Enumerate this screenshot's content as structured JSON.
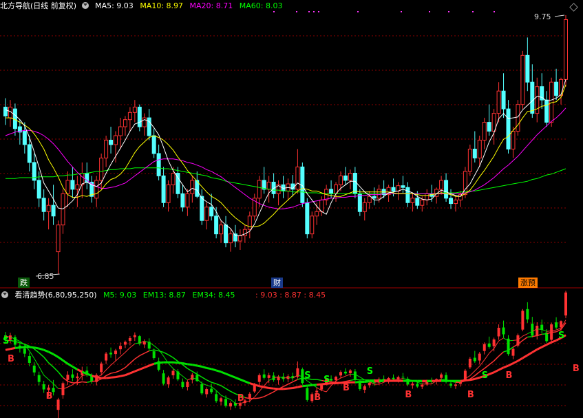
{
  "main_header": {
    "stock_name": "北方导航",
    "period": "(日线 前复权)",
    "ma5": "MA5: 9.03",
    "ma10": "MA10: 8.97",
    "ma20": "MA20: 8.71",
    "ma60": "MA60: 8.03"
  },
  "sub_header": {
    "indicator": "看清趋势(6,80,95,250)",
    "m5": "M5: 9.03",
    "em13": "EM13: 8.87",
    "em34": "EM34: 8.45",
    "values": ": 9.03 : 8.87 : 8.45"
  },
  "markers": {
    "left": "跌",
    "mid": "财",
    "right": "涨预"
  },
  "price_labels": {
    "high": "9.75",
    "low": "6.85"
  },
  "signals": {
    "buy": "B",
    "sell": "S"
  },
  "colors": {
    "up": "#ff3232",
    "down": "#54ffff",
    "ma5": "#ffffff",
    "ma10": "#ffff00",
    "ma20": "#ff00ff",
    "ma60": "#00ff00",
    "sub_up": "#ff3232",
    "sub_down": "#00e000",
    "grid": "#8b0000"
  },
  "chart_data": {
    "type": "candlestick",
    "title": "北方导航 (日线 前复权)",
    "y_high": 9.75,
    "y_low": 6.85,
    "candles": [
      [
        8.72,
        8.82,
        8.52,
        8.62
      ],
      [
        8.6,
        8.8,
        8.5,
        8.72
      ],
      [
        8.7,
        8.76,
        8.4,
        8.48
      ],
      [
        8.5,
        8.58,
        8.3,
        8.44
      ],
      [
        8.45,
        8.55,
        8.2,
        8.3
      ],
      [
        8.3,
        8.4,
        8.0,
        8.1
      ],
      [
        8.1,
        8.2,
        7.8,
        7.9
      ],
      [
        7.9,
        8.0,
        7.6,
        7.7
      ],
      [
        7.7,
        7.8,
        7.45,
        7.55
      ],
      [
        7.55,
        7.7,
        7.35,
        7.62
      ],
      [
        7.62,
        7.85,
        7.4,
        7.5
      ],
      [
        7.1,
        7.45,
        6.85,
        7.4
      ],
      [
        7.4,
        7.8,
        7.3,
        7.75
      ],
      [
        7.75,
        8.0,
        7.6,
        7.9
      ],
      [
        7.9,
        8.05,
        7.7,
        7.8
      ],
      [
        7.8,
        7.95,
        7.6,
        7.85
      ],
      [
        7.85,
        8.1,
        7.7,
        7.98
      ],
      [
        7.98,
        8.1,
        7.8,
        7.88
      ],
      [
        7.88,
        7.95,
        7.65,
        7.72
      ],
      [
        7.7,
        7.95,
        7.6,
        7.9
      ],
      [
        7.9,
        8.2,
        7.8,
        8.15
      ],
      [
        8.15,
        8.4,
        8.05,
        8.35
      ],
      [
        8.35,
        8.5,
        8.2,
        8.3
      ],
      [
        8.3,
        8.45,
        8.1,
        8.4
      ],
      [
        8.4,
        8.6,
        8.25,
        8.5
      ],
      [
        8.5,
        8.62,
        8.4,
        8.58
      ],
      [
        8.58,
        8.72,
        8.45,
        8.66
      ],
      [
        8.66,
        8.8,
        8.55,
        8.72
      ],
      [
        8.72,
        8.75,
        8.45,
        8.5
      ],
      [
        8.5,
        8.65,
        8.4,
        8.6
      ],
      [
        8.6,
        8.7,
        8.35,
        8.4
      ],
      [
        8.4,
        8.48,
        8.15,
        8.2
      ],
      [
        8.2,
        8.3,
        7.9,
        7.95
      ],
      [
        7.95,
        8.05,
        7.6,
        7.65
      ],
      [
        7.65,
        7.9,
        7.55,
        7.85
      ],
      [
        7.85,
        8.05,
        7.75,
        7.98
      ],
      [
        7.98,
        8.05,
        7.7,
        7.75
      ],
      [
        7.75,
        7.85,
        7.55,
        7.6
      ],
      [
        7.6,
        7.8,
        7.5,
        7.75
      ],
      [
        7.75,
        7.95,
        7.65,
        7.9
      ],
      [
        7.9,
        8.0,
        7.7,
        7.72
      ],
      [
        7.72,
        7.8,
        7.4,
        7.45
      ],
      [
        7.45,
        7.65,
        7.35,
        7.6
      ],
      [
        7.6,
        7.75,
        7.45,
        7.5
      ],
      [
        7.5,
        7.6,
        7.25,
        7.3
      ],
      [
        7.3,
        7.45,
        7.2,
        7.4
      ],
      [
        7.4,
        7.5,
        7.15,
        7.2
      ],
      [
        7.2,
        7.35,
        7.1,
        7.3
      ],
      [
        7.3,
        7.4,
        7.15,
        7.22
      ],
      [
        7.22,
        7.35,
        7.12,
        7.28
      ],
      [
        7.28,
        7.4,
        7.2,
        7.35
      ],
      [
        7.35,
        7.55,
        7.25,
        7.5
      ],
      [
        7.5,
        7.75,
        7.45,
        7.7
      ],
      [
        7.7,
        7.95,
        7.6,
        7.9
      ],
      [
        7.9,
        8.05,
        7.75,
        7.8
      ],
      [
        7.8,
        7.95,
        7.65,
        7.88
      ],
      [
        7.88,
        7.98,
        7.7,
        7.75
      ],
      [
        7.75,
        7.9,
        7.62,
        7.85
      ],
      [
        7.85,
        7.95,
        7.7,
        7.78
      ],
      [
        7.78,
        7.92,
        7.68,
        7.86
      ],
      [
        7.86,
        7.96,
        7.72,
        7.8
      ],
      [
        7.8,
        8.25,
        7.75,
        8.05
      ],
      [
        8.05,
        8.1,
        7.6,
        7.65
      ],
      [
        7.65,
        7.7,
        7.25,
        7.3
      ],
      [
        7.3,
        7.55,
        7.25,
        7.5
      ],
      [
        7.5,
        7.65,
        7.4,
        7.55
      ],
      [
        7.55,
        7.72,
        7.5,
        7.68
      ],
      [
        7.68,
        7.85,
        7.62,
        7.8
      ],
      [
        7.8,
        7.9,
        7.7,
        7.75
      ],
      [
        7.75,
        7.88,
        7.66,
        7.85
      ],
      [
        7.85,
        8.0,
        7.78,
        7.95
      ],
      [
        7.95,
        8.05,
        7.85,
        7.9
      ],
      [
        7.9,
        8.02,
        7.8,
        7.98
      ],
      [
        7.98,
        8.05,
        7.7,
        7.75
      ],
      [
        7.75,
        7.8,
        7.5,
        7.55
      ],
      [
        7.55,
        7.7,
        7.45,
        7.65
      ],
      [
        7.65,
        7.78,
        7.58,
        7.72
      ],
      [
        7.72,
        7.82,
        7.62,
        7.7
      ],
      [
        7.7,
        7.85,
        7.65,
        7.8
      ],
      [
        7.8,
        7.9,
        7.7,
        7.74
      ],
      [
        7.74,
        7.85,
        7.66,
        7.82
      ],
      [
        7.82,
        7.92,
        7.72,
        7.78
      ],
      [
        7.78,
        7.88,
        7.68,
        7.84
      ],
      [
        7.84,
        7.95,
        7.76,
        7.82
      ],
      [
        7.82,
        7.88,
        7.6,
        7.65
      ],
      [
        7.65,
        7.75,
        7.55,
        7.7
      ],
      [
        7.7,
        7.78,
        7.58,
        7.62
      ],
      [
        7.62,
        7.72,
        7.55,
        7.68
      ],
      [
        7.68,
        7.8,
        7.62,
        7.75
      ],
      [
        7.75,
        7.85,
        7.66,
        7.72
      ],
      [
        7.72,
        7.82,
        7.64,
        7.8
      ],
      [
        7.8,
        7.95,
        7.74,
        7.9
      ],
      [
        7.9,
        7.98,
        7.66,
        7.7
      ],
      [
        7.7,
        7.8,
        7.58,
        7.64
      ],
      [
        7.64,
        7.72,
        7.55,
        7.68
      ],
      [
        7.68,
        7.78,
        7.6,
        7.74
      ],
      [
        7.74,
        8.05,
        7.7,
        8.0
      ],
      [
        8.0,
        8.3,
        7.95,
        8.25
      ],
      [
        8.25,
        8.45,
        8.1,
        8.15
      ],
      [
        8.15,
        8.4,
        8.05,
        8.35
      ],
      [
        8.35,
        8.6,
        8.25,
        8.55
      ],
      [
        8.55,
        8.75,
        8.4,
        8.45
      ],
      [
        8.45,
        8.7,
        8.3,
        8.65
      ],
      [
        8.65,
        9.0,
        8.55,
        8.9
      ],
      [
        8.9,
        9.1,
        8.6,
        8.7
      ],
      [
        8.7,
        8.8,
        8.2,
        8.25
      ],
      [
        8.25,
        8.5,
        8.15,
        8.45
      ],
      [
        8.45,
        8.8,
        8.4,
        8.75
      ],
      [
        8.75,
        9.35,
        8.7,
        9.3
      ],
      [
        9.3,
        9.5,
        8.9,
        9.0
      ],
      [
        9.0,
        9.2,
        8.6,
        8.65
      ],
      [
        8.65,
        9.05,
        8.55,
        8.95
      ],
      [
        8.95,
        9.1,
        8.7,
        8.8
      ],
      [
        8.8,
        8.9,
        8.5,
        8.55
      ],
      [
        8.55,
        9.05,
        8.5,
        9.0
      ],
      [
        9.0,
        9.15,
        8.8,
        8.85
      ],
      [
        8.85,
        9.05,
        8.75,
        9.03
      ],
      [
        9.03,
        9.75,
        8.95,
        9.7
      ]
    ],
    "ma5": [
      8.69,
      8.67,
      8.63,
      8.58,
      8.51,
      8.38,
      8.22,
      8.05,
      7.87,
      7.78,
      7.69,
      7.59,
      7.58,
      7.62,
      7.67,
      7.74,
      7.86,
      7.88,
      7.85,
      7.83,
      7.87,
      7.98,
      8.08,
      8.17,
      8.26,
      8.35,
      8.45,
      8.53,
      8.55,
      8.58,
      8.56,
      8.49,
      8.41,
      8.27,
      8.12,
      8.01,
      7.93,
      7.85,
      7.77,
      7.81,
      7.79,
      7.7,
      7.66,
      7.63,
      7.55,
      7.45,
      7.4,
      7.36,
      7.28,
      7.28,
      7.3,
      7.33,
      7.41,
      7.53,
      7.65,
      7.76,
      7.81,
      7.84,
      7.81,
      7.82,
      7.81,
      7.87,
      7.84,
      7.75,
      7.68,
      7.61,
      7.55,
      7.52,
      7.65,
      7.75,
      7.81,
      7.85,
      7.89,
      7.89,
      7.83,
      7.77,
      7.73,
      7.68,
      7.68,
      7.72,
      7.76,
      7.77,
      7.78,
      7.8,
      7.78,
      7.76,
      7.72,
      7.69,
      7.68,
      7.69,
      7.75,
      7.79,
      7.77,
      7.75,
      7.73,
      7.72,
      7.8,
      7.86,
      7.96,
      8.06,
      8.19,
      8.33,
      8.43,
      8.59,
      8.65,
      8.59,
      8.6,
      8.61,
      8.69,
      8.74,
      8.79,
      8.84,
      8.83,
      8.79,
      8.8,
      8.82,
      8.86,
      9.03
    ],
    "ma10": [
      8.6,
      8.6,
      8.58,
      8.55,
      8.52,
      8.48,
      8.42,
      8.34,
      8.25,
      8.13,
      8.04,
      7.94,
      7.82,
      7.74,
      7.71,
      7.71,
      7.73,
      7.72,
      7.74,
      7.75,
      7.79,
      7.86,
      7.91,
      7.93,
      7.97,
      8.03,
      8.12,
      8.21,
      8.28,
      8.33,
      8.38,
      8.4,
      8.38,
      8.35,
      8.3,
      8.24,
      8.16,
      8.09,
      8.01,
      7.95,
      7.89,
      7.83,
      7.77,
      7.72,
      7.69,
      7.65,
      7.59,
      7.53,
      7.48,
      7.44,
      7.4,
      7.38,
      7.38,
      7.39,
      7.42,
      7.47,
      7.52,
      7.58,
      7.63,
      7.68,
      7.73,
      7.78,
      7.81,
      7.8,
      7.78,
      7.78,
      7.76,
      7.74,
      7.73,
      7.72,
      7.72,
      7.74,
      7.76,
      7.78,
      7.77,
      7.77,
      7.77,
      7.77,
      7.77,
      7.77,
      7.77,
      7.76,
      7.75,
      7.75,
      7.75,
      7.75,
      7.74,
      7.73,
      7.73,
      7.74,
      7.75,
      7.76,
      7.75,
      7.74,
      7.72,
      7.72,
      7.75,
      7.79,
      7.86,
      7.94,
      8.01,
      8.09,
      8.17,
      8.27,
      8.36,
      8.39,
      8.46,
      8.52,
      8.6,
      8.67,
      8.68,
      8.7,
      8.73,
      8.74,
      8.77,
      8.78,
      8.83,
      8.97
    ],
    "ma20": [
      8.4,
      8.42,
      8.44,
      8.45,
      8.46,
      8.46,
      8.45,
      8.43,
      8.4,
      8.36,
      8.31,
      8.25,
      8.18,
      8.11,
      8.05,
      7.99,
      7.94,
      7.9,
      7.86,
      7.83,
      7.81,
      7.81,
      7.82,
      7.83,
      7.85,
      7.87,
      7.91,
      7.95,
      7.99,
      8.03,
      8.07,
      8.11,
      8.13,
      8.14,
      8.14,
      8.14,
      8.13,
      8.12,
      8.1,
      8.09,
      8.07,
      8.05,
      8.02,
      8.0,
      7.97,
      7.94,
      7.9,
      7.86,
      7.82,
      7.78,
      7.74,
      7.7,
      7.67,
      7.64,
      7.62,
      7.6,
      7.59,
      7.58,
      7.58,
      7.59,
      7.6,
      7.62,
      7.64,
      7.65,
      7.66,
      7.67,
      7.68,
      7.69,
      7.7,
      7.7,
      7.71,
      7.71,
      7.72,
      7.72,
      7.73,
      7.73,
      7.74,
      7.74,
      7.74,
      7.75,
      7.75,
      7.75,
      7.75,
      7.75,
      7.75,
      7.75,
      7.75,
      7.75,
      7.75,
      7.75,
      7.75,
      7.75,
      7.75,
      7.75,
      7.75,
      7.75,
      7.76,
      7.77,
      7.79,
      7.82,
      7.85,
      7.89,
      7.93,
      7.98,
      8.03,
      8.07,
      8.12,
      8.17,
      8.23,
      8.29,
      8.35,
      8.41,
      8.46,
      8.51,
      8.56,
      8.6,
      8.65,
      8.71
    ],
    "ma60": [
      7.92,
      7.92,
      7.92,
      7.93,
      7.93,
      7.93,
      7.93,
      7.94,
      7.94,
      7.94,
      7.94,
      7.95,
      7.95,
      7.96,
      7.96,
      7.97,
      7.98,
      7.98,
      7.99,
      8.0,
      8.0,
      8.01,
      8.02,
      8.02,
      8.03,
      8.03,
      8.03,
      8.04,
      8.04,
      8.04,
      8.04,
      8.04,
      8.04,
      8.03,
      8.03,
      8.02,
      8.01,
      8.0,
      7.99,
      7.98,
      7.97,
      7.96,
      7.95,
      7.93,
      7.92,
      7.91,
      7.89,
      7.88,
      7.87,
      7.86,
      7.85,
      7.84,
      7.83,
      7.82,
      7.81,
      7.8,
      7.79,
      7.79,
      7.78,
      7.78,
      7.77,
      7.77,
      7.77,
      7.76,
      7.76,
      7.76,
      7.75,
      7.75,
      7.75,
      7.75,
      7.75,
      7.75,
      7.75,
      7.75,
      7.75,
      7.75,
      7.75,
      7.75,
      7.75,
      7.75,
      7.75,
      7.75,
      7.75,
      7.75,
      7.75,
      7.75,
      7.75,
      7.75,
      7.75,
      7.75,
      7.75,
      7.76,
      7.76,
      7.76,
      7.76,
      7.77,
      7.77,
      7.78,
      7.78,
      7.79,
      7.8,
      7.81,
      7.82,
      7.83,
      7.84,
      7.85,
      7.86,
      7.87,
      7.88,
      7.89,
      7.91,
      7.92,
      7.94,
      7.96,
      7.97,
      7.99,
      8.01,
      8.03
    ]
  }
}
